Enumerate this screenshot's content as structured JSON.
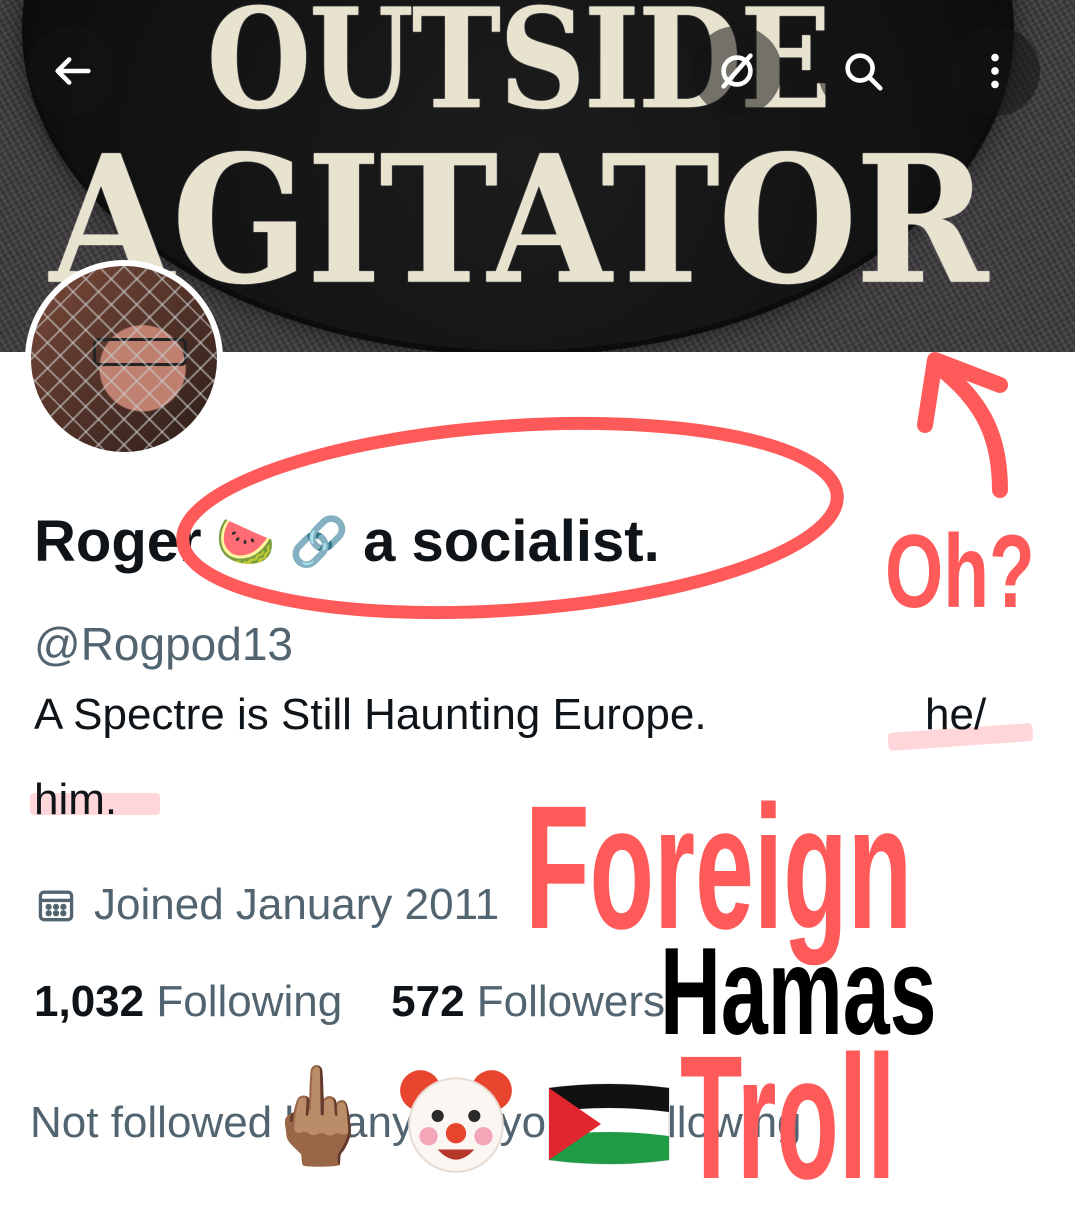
{
  "header": {
    "banner_text_line1": "OUTSIDE",
    "banner_text_line2": "AGITATOR",
    "back_icon": "arrow-left-icon",
    "grok_icon": "grok-icon",
    "search_icon": "search-icon",
    "more_icon": "more-vertical-icon"
  },
  "profile": {
    "name_prefix": "Roger",
    "name_emoji_1": "🍉",
    "name_emoji_2": "🔗",
    "name_suffix": "a socialist.",
    "handle": "@Rogpod13",
    "bio_line1": "A Spectre is Still Haunting Europe.",
    "bio_he": "he/",
    "bio_line2": "him.",
    "joined": "Joined January 2011",
    "following_count": "1,032",
    "following_label": "Following",
    "followers_count": "572",
    "followers_label": "Followers",
    "not_followed": "Not followed by anyone you're following"
  },
  "annotations": {
    "oh": "Oh?",
    "foreign": "Foreign",
    "hamas": "Hamas",
    "troll": "Troll",
    "color_red": "#ff5a5a",
    "color_black": "#000000"
  },
  "stickers": {
    "finger": "🖕🏽",
    "clown": "clown-face-icon",
    "flag": "palestine-flag-icon"
  },
  "theme": {
    "text_primary": "#0f1419",
    "text_secondary": "#536471"
  }
}
